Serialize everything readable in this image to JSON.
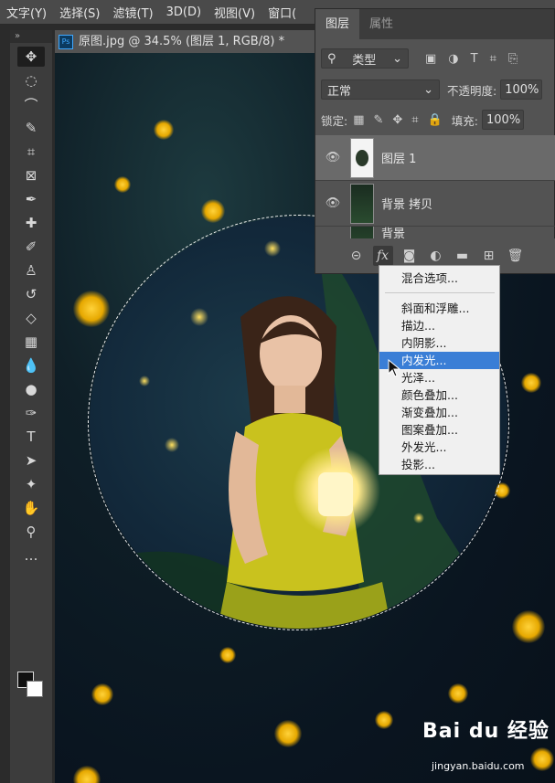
{
  "menubar": {
    "items": [
      "文字(Y)",
      "选择(S)",
      "滤镜(T)",
      "3D(D)",
      "视图(V)",
      "窗口("
    ]
  },
  "toolbox": {
    "header": "»",
    "tools": [
      {
        "name": "move-tool",
        "glyph": "✥"
      },
      {
        "name": "marquee-tool",
        "glyph": "◌"
      },
      {
        "name": "lasso-tool",
        "glyph": "⌒"
      },
      {
        "name": "quick-select-tool",
        "glyph": "✎"
      },
      {
        "name": "crop-tool",
        "glyph": "⌗"
      },
      {
        "name": "frame-tool",
        "glyph": "⊠"
      },
      {
        "name": "eyedropper-tool",
        "glyph": "✒"
      },
      {
        "name": "healing-brush-tool",
        "glyph": "✚"
      },
      {
        "name": "brush-tool",
        "glyph": "✐"
      },
      {
        "name": "stamp-tool",
        "glyph": "♙"
      },
      {
        "name": "history-brush-tool",
        "glyph": "↺"
      },
      {
        "name": "eraser-tool",
        "glyph": "◇"
      },
      {
        "name": "gradient-tool",
        "glyph": "▦"
      },
      {
        "name": "blur-tool",
        "glyph": "💧"
      },
      {
        "name": "dodge-tool",
        "glyph": "●"
      },
      {
        "name": "pen-tool",
        "glyph": "✑"
      },
      {
        "name": "type-tool",
        "glyph": "T"
      },
      {
        "name": "path-select-tool",
        "glyph": "➤"
      },
      {
        "name": "shape-tool",
        "glyph": "✦"
      },
      {
        "name": "hand-tool",
        "glyph": "✋"
      },
      {
        "name": "zoom-tool",
        "glyph": "⚲"
      },
      {
        "name": "more-tools",
        "glyph": "…"
      }
    ]
  },
  "document": {
    "tab_title": "原图.jpg @ 34.5% (图层 1, RGB/8) *"
  },
  "layers_panel": {
    "tabs": [
      "图层",
      "属性"
    ],
    "filter_label": "类型",
    "blend_mode": "正常",
    "opacity_label": "不透明度:",
    "opacity_value": "100%",
    "lock_label": "锁定:",
    "fill_label": "填充:",
    "fill_value": "100%",
    "layers": [
      {
        "name": "图层 1",
        "selected": true
      },
      {
        "name": "背景 拷贝",
        "selected": false
      },
      {
        "name": "背景",
        "selected": false
      }
    ]
  },
  "fx_menu": {
    "items": [
      {
        "label": "混合选项...",
        "highlight": false
      },
      {
        "label": "斜面和浮雕...",
        "highlight": false
      },
      {
        "label": "描边...",
        "highlight": false
      },
      {
        "label": "内阴影...",
        "highlight": false
      },
      {
        "label": "内发光...",
        "highlight": true
      },
      {
        "label": "光泽...",
        "highlight": false
      },
      {
        "label": "颜色叠加...",
        "highlight": false
      },
      {
        "label": "渐变叠加...",
        "highlight": false
      },
      {
        "label": "图案叠加...",
        "highlight": false
      },
      {
        "label": "外发光...",
        "highlight": false
      },
      {
        "label": "投影...",
        "highlight": false
      }
    ]
  },
  "watermark": {
    "brand": "Bai du 经验",
    "url": "jingyan.baidu.com"
  },
  "colors": {
    "highlight": "#3a7ed6",
    "bokeh": "#ffd23a",
    "dress": "#c9c21e"
  }
}
